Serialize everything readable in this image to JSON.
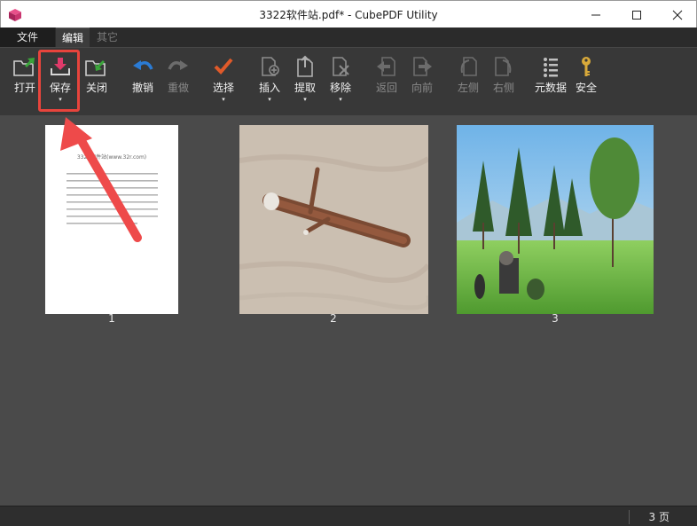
{
  "window": {
    "title": "3322软件站.pdf* - CubePDF Utility"
  },
  "menu": {
    "tabs": [
      {
        "label": "文件"
      },
      {
        "label": "编辑"
      },
      {
        "label": "其它"
      }
    ]
  },
  "ribbon": {
    "open": "打开",
    "save": "保存",
    "close": "关闭",
    "undo": "撤销",
    "redo": "重做",
    "select": "选择",
    "insert": "插入",
    "extract": "提取",
    "remove": "移除",
    "back": "返回",
    "forward": "向前",
    "rotate_left": "左侧",
    "rotate_right": "右侧",
    "metadata": "元数据",
    "security": "安全",
    "dropdown_glyph": "▾"
  },
  "pages": [
    {
      "number": "1",
      "doc_heading": "3322软件站(www.32r.com)",
      "thumb_kind": "text-document"
    },
    {
      "number": "2",
      "thumb_kind": "wooden-stick-image"
    },
    {
      "number": "3",
      "thumb_kind": "game-landscape-image"
    }
  ],
  "status": {
    "page_count": "3 页"
  },
  "colors": {
    "ribbon_bg": "#383838",
    "content_bg": "#4a4a4a",
    "highlight": "#e8443c",
    "save_icon": "#e03a6a",
    "open_arrow": "#3aa53a",
    "undo_blue": "#2b7bd4",
    "select_check": "#e05a2a"
  }
}
